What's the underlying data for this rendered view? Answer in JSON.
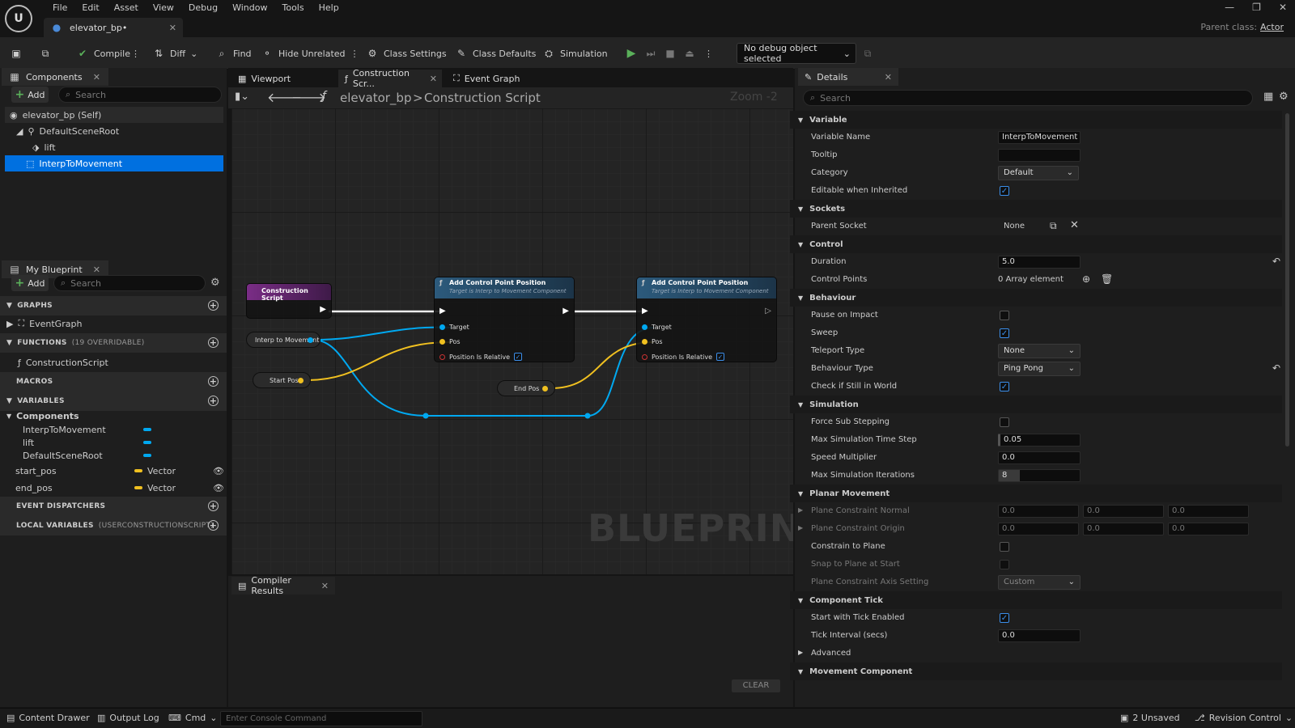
{
  "menu": [
    "File",
    "Edit",
    "Asset",
    "View",
    "Debug",
    "Window",
    "Tools",
    "Help"
  ],
  "document_tab": "elevator_bp•",
  "parent_class": {
    "label": "Parent class:",
    "value": "Actor"
  },
  "toolbar": {
    "compile": "Compile",
    "diff": "Diff",
    "find": "Find",
    "hide_unrelated": "Hide Unrelated",
    "class_settings": "Class Settings",
    "class_defaults": "Class Defaults",
    "simulation": "Simulation",
    "debug_object": "No debug object selected"
  },
  "components_panel": {
    "tab": "Components",
    "add": "Add",
    "search_placeholder": "Search",
    "items": [
      "elevator_bp (Self)",
      "DefaultSceneRoot",
      "lift",
      "InterpToMovement"
    ]
  },
  "my_blueprint": {
    "tab": "My Blueprint",
    "add": "Add",
    "search_placeholder": "Search",
    "graphs": "GRAPHS",
    "event_graph": "EventGraph",
    "functions": "FUNCTIONS",
    "functions_note": "(19 OVERRIDABLE)",
    "construction_script": "ConstructionScript",
    "macros": "MACROS",
    "variables": "VARIABLES",
    "components_group": "Components",
    "component_vars": [
      "InterpToMovement",
      "lift",
      "DefaultSceneRoot"
    ],
    "vars": [
      {
        "name": "start_pos",
        "type": "Vector"
      },
      {
        "name": "end_pos",
        "type": "Vector"
      }
    ],
    "event_dispatchers": "EVENT DISPATCHERS",
    "local_variables": "LOCAL VARIABLES",
    "local_note": "(USERCONSTRUCTIONSCRIPT)"
  },
  "graph_tabs": [
    "Viewport",
    "Construction Scr...",
    "Event Graph"
  ],
  "breadcrumb": {
    "root": "elevator_bp",
    "sep": ">",
    "current": "Construction Script",
    "zoom": "Zoom -2"
  },
  "nodes": {
    "construction": "Construction Script",
    "add_title": "Add Control Point Position",
    "add_sub": "Target is Interp to Movement Component",
    "target": "Target",
    "pos": "Pos",
    "relative": "Position Is Relative",
    "interp_var": "Interp to Movement",
    "start_var": "Start Pos",
    "end_var": "End Pos"
  },
  "watermark": "BLUEPRINT",
  "compiler": {
    "tab": "Compiler Results",
    "clear": "CLEAR"
  },
  "details": {
    "tab": "Details",
    "search_placeholder": "Search",
    "variable": "Variable",
    "variable_name_lbl": "Variable Name",
    "variable_name": "InterpToMovement",
    "tooltip": "Tooltip",
    "category": "Category",
    "category_value": "Default",
    "editable": "Editable when Inherited",
    "sockets": "Sockets",
    "parent_socket": "Parent Socket",
    "parent_socket_value": "None",
    "control": "Control",
    "duration": "Duration",
    "duration_value": "5.0",
    "control_points": "Control Points",
    "control_points_value": "0 Array element",
    "behaviour": "Behaviour",
    "pause": "Pause on Impact",
    "sweep": "Sweep",
    "teleport": "Teleport Type",
    "teleport_value": "None",
    "behaviour_type": "Behaviour Type",
    "behaviour_type_value": "Ping Pong",
    "check_world": "Check if Still in World",
    "simulation": "Simulation",
    "force_sub": "Force Sub Stepping",
    "max_step": "Max Simulation Time Step",
    "max_step_value": "0.05",
    "speed": "Speed Multiplier",
    "speed_value": "0.0",
    "max_iter": "Max Simulation Iterations",
    "max_iter_value": "8",
    "planar": "Planar Movement",
    "plane_normal": "Plane Constraint Normal",
    "plane_origin": "Plane Constraint Origin",
    "zero": "0.0",
    "constrain": "Constrain to Plane",
    "snap": "Snap to Plane at Start",
    "axis_setting": "Plane Constraint Axis Setting",
    "axis_value": "Custom",
    "component_tick": "Component Tick",
    "start_tick": "Start with Tick Enabled",
    "tick_interval": "Tick Interval (secs)",
    "tick_value": "0.0",
    "advanced": "Advanced",
    "movement": "Movement Component"
  },
  "status": {
    "content_drawer": "Content Drawer",
    "output_log": "Output Log",
    "cmd": "Cmd",
    "console_placeholder": "Enter Console Command",
    "unsaved": "2 Unsaved",
    "revision": "Revision Control"
  },
  "colors": {
    "accent": "#0070e0",
    "exec_head": "#7a2d86",
    "func_head": "#2c5a7c",
    "vector": "#f0c020",
    "object": "#00a8f0"
  }
}
